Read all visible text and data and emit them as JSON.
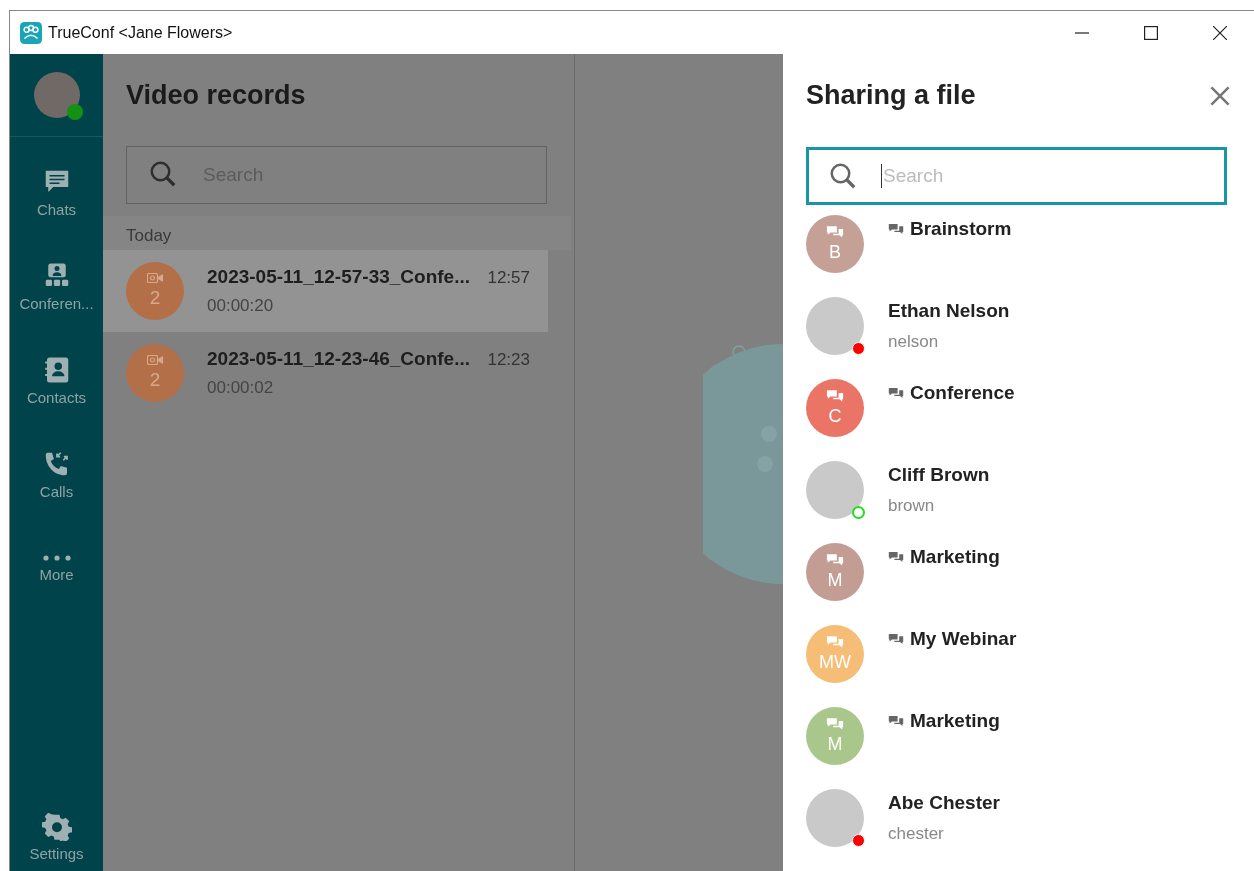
{
  "window": {
    "title": "TrueConf <Jane Flowers>"
  },
  "sidebar": {
    "profile": {
      "color": "#139113"
    },
    "items": [
      {
        "kind": "chats",
        "label": "Chats"
      },
      {
        "kind": "conferences",
        "label": "Conferen..."
      },
      {
        "kind": "contacts",
        "label": "Contacts"
      },
      {
        "kind": "calls",
        "label": "Calls"
      },
      {
        "kind": "more",
        "label": "More"
      }
    ],
    "footer": {
      "kind": "settings",
      "label": "Settings"
    }
  },
  "records": {
    "title": "Video records",
    "search": {
      "placeholder": "Search"
    },
    "group": "Today",
    "items": [
      {
        "title": "2023-05-11_12-57-33_Confe...",
        "time": "12:57",
        "duration": "00:00:20",
        "participants": "2",
        "selected": true
      },
      {
        "title": "2023-05-11_12-23-46_Confe...",
        "time": "12:23",
        "duration": "00:00:02",
        "participants": "2",
        "selected": false
      }
    ]
  },
  "share_panel": {
    "title": "Sharing a file",
    "search": {
      "placeholder": "Search"
    },
    "contacts": [
      {
        "kind": "group",
        "name": "Brainstorm",
        "initials": "B",
        "color": "#c4a097"
      },
      {
        "kind": "user",
        "name": "Ethan Nelson",
        "login": "nelson",
        "color": "#ff0000",
        "hollow": false
      },
      {
        "kind": "group",
        "name": "Conference",
        "initials": "C",
        "color": "#ea7566"
      },
      {
        "kind": "user",
        "name": "Cliff Brown",
        "login": "brown",
        "color": "#22dd22",
        "hollow": true
      },
      {
        "kind": "group",
        "name": "Marketing",
        "initials": "M",
        "color": "#c39d94"
      },
      {
        "kind": "group",
        "name": "My Webinar",
        "initials": "MW",
        "color": "#f6bd77"
      },
      {
        "kind": "group",
        "name": "Marketing",
        "initials": "M",
        "color": "#a9c78a"
      },
      {
        "kind": "user",
        "name": "Abe Chester",
        "login": "chester",
        "color": "#ff0000",
        "hollow": false
      }
    ]
  }
}
